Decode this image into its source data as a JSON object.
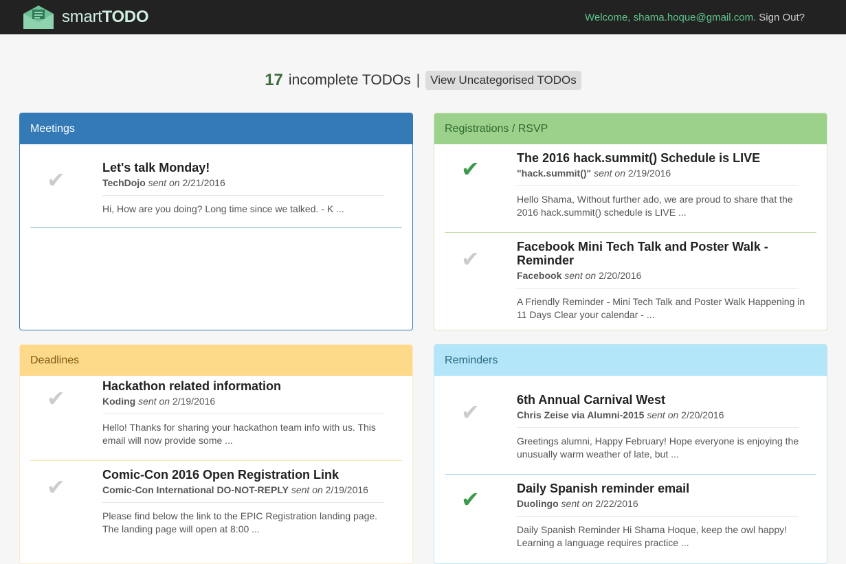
{
  "header": {
    "brand_light": "smart",
    "brand_bold": "TODO",
    "welcome": "Welcome, shama.hoque@gmail.com.",
    "signout": "Sign Out?"
  },
  "summary": {
    "count": "17",
    "label": "incomplete TODOs",
    "separator": "|",
    "view_button": "View Uncategorised TODOs"
  },
  "panels": {
    "meetings": {
      "title": "Meetings",
      "items": [
        {
          "title": "Let's talk Monday!",
          "sender": "TechDojo",
          "sent_label": "sent on",
          "date": "2/21/2016",
          "snippet": "Hi, How are you doing? Long time since we talked. - K ...",
          "done": false
        }
      ]
    },
    "registrations": {
      "title": "Registrations / RSVP",
      "items": [
        {
          "title": "The 2016 hack.summit() Schedule is LIVE",
          "sender": "\"hack.summit()\"",
          "sent_label": "sent on",
          "date": "2/19/2016",
          "snippet": "Hello Shama, Without further ado, we are proud to share that the 2016 hack.summit() schedule is LIVE ...",
          "done": true
        },
        {
          "title": "Facebook Mini Tech Talk and Poster Walk - Reminder",
          "sender": "Facebook",
          "sent_label": "sent on",
          "date": "2/20/2016",
          "snippet": "A Friendly Reminder - Mini Tech Talk and Poster Walk Happening in 11 Days Clear your calendar - ...",
          "done": false
        }
      ]
    },
    "deadlines": {
      "title": "Deadlines",
      "items": [
        {
          "title": "Hackathon related information",
          "sender": "Koding",
          "sent_label": "sent on",
          "date": "2/19/2016",
          "snippet": "Hello! Thanks for sharing your hackathon team info with us. This email will now provide some ...",
          "done": false
        },
        {
          "title": "Comic-Con 2016 Open Registration Link",
          "sender": "Comic-Con International DO-NOT-REPLY",
          "sent_label": "sent on",
          "date": "2/19/2016",
          "snippet": "Please find below the link to the EPIC Registration landing page. The landing page will open at 8:00 ...",
          "done": false
        }
      ]
    },
    "reminders": {
      "title": "Reminders",
      "items": [
        {
          "title": "6th Annual Carnival West",
          "sender": "Chris Zeise via Alumni-2015",
          "sent_label": "sent on",
          "date": "2/20/2016",
          "snippet": "Greetings alumni, Happy February! Hope everyone is enjoying the unusually warm weather of late, but ...",
          "done": false
        },
        {
          "title": "Daily Spanish reminder email",
          "sender": "Duolingo",
          "sent_label": "sent on",
          "date": "2/22/2016",
          "snippet": "Daily Spanish Reminder Hi Shama Hoque, keep the owl happy! Learning a language requires practice ...",
          "done": true
        }
      ]
    }
  },
  "colors": {
    "navbar": "#222222",
    "meetings": "#337ab7",
    "registrations": "#9bd18a",
    "deadlines": "#fdd98a",
    "reminders": "#b3e6f8",
    "check_done": "#3a9a4a",
    "check_pending": "#cccccc"
  },
  "icons": {
    "logo": "envelope-list-icon",
    "check": "checkmark-icon"
  }
}
